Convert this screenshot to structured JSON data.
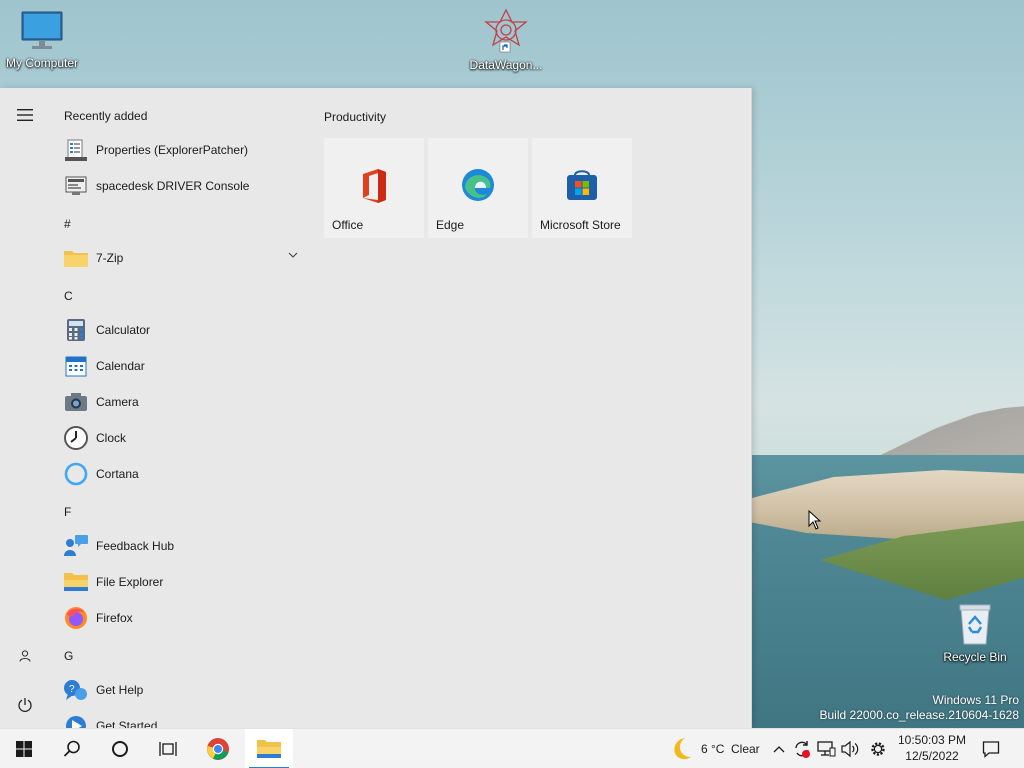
{
  "desktop": {
    "icons": [
      {
        "label": "My Computer"
      },
      {
        "label": "DataWagon..."
      },
      {
        "label": "Recycle Bin"
      }
    ],
    "watermark": {
      "line1": "Windows 11 Pro",
      "line2": "Build 22000.co_release.210604-1628"
    }
  },
  "start_menu": {
    "recently_added_label": "Recently added",
    "recently_added": [
      {
        "label": "Properties (ExplorerPatcher)",
        "icon": "properties-icon"
      },
      {
        "label": "spacedesk DRIVER Console",
        "icon": "spacedesk-icon"
      }
    ],
    "sections": [
      {
        "header": "#",
        "items": [
          {
            "label": "7-Zip",
            "icon": "folder-icon",
            "expandable": true
          }
        ]
      },
      {
        "header": "C",
        "items": [
          {
            "label": "Calculator",
            "icon": "calculator-icon"
          },
          {
            "label": "Calendar",
            "icon": "calendar-icon"
          },
          {
            "label": "Camera",
            "icon": "camera-icon"
          },
          {
            "label": "Clock",
            "icon": "clock-icon"
          },
          {
            "label": "Cortana",
            "icon": "cortana-icon"
          }
        ]
      },
      {
        "header": "F",
        "items": [
          {
            "label": "Feedback Hub",
            "icon": "feedback-hub-icon"
          },
          {
            "label": "File Explorer",
            "icon": "file-explorer-icon"
          },
          {
            "label": "Firefox",
            "icon": "firefox-icon"
          }
        ]
      },
      {
        "header": "G",
        "items": [
          {
            "label": "Get Help",
            "icon": "get-help-icon"
          },
          {
            "label": "Get Started",
            "icon": "get-started-icon"
          }
        ]
      }
    ],
    "tile_group": {
      "title": "Productivity",
      "tiles": [
        {
          "label": "Office",
          "icon": "office-icon"
        },
        {
          "label": "Edge",
          "icon": "edge-icon"
        },
        {
          "label": "Microsoft Store",
          "icon": "microsoft-store-icon"
        }
      ]
    }
  },
  "taskbar": {
    "weather": {
      "temp": "6 °C",
      "condition": "Clear"
    },
    "clock": {
      "time": "10:50:03 PM",
      "date": "12/5/2022"
    }
  },
  "colors": {
    "accent": "#2d7dd2",
    "start_bg": "#e8e8e8",
    "taskbar_bg": "#f3f3f3"
  }
}
